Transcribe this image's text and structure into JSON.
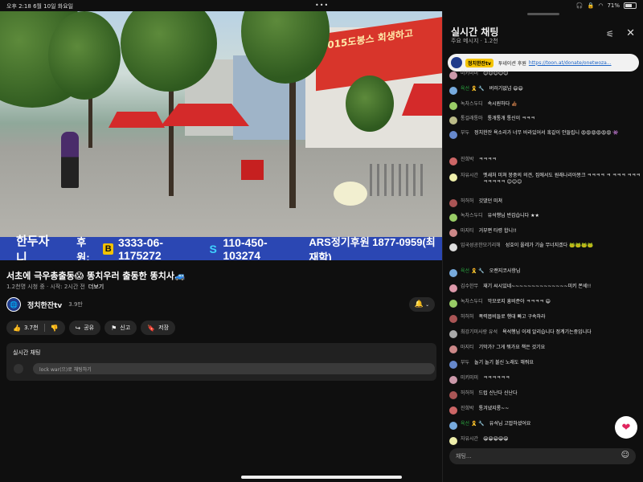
{
  "status": {
    "time": "오후 2:18",
    "date": "6월 10일 화요일",
    "battery": "71%"
  },
  "video": {
    "banner_top": "1015도봉스 회생하고",
    "ticker": {
      "name": "한두자니",
      "donate_label": "후원:",
      "acc1": "3333-06-1175272",
      "acc2": "110-450-103274",
      "ars": "ARS정기후원 1877-0959(최재학)"
    }
  },
  "info": {
    "title": "서초에 극우총출동😱 똥치우러 출동한 똥치사🚙",
    "meta": "1.2천명 시청 중 · 시작: 2시간 전",
    "more": "더보기",
    "channel": "정치한잔tv",
    "subs": "3.9만",
    "likes": "3.7천",
    "share": "공유",
    "report": "신고",
    "save": "저장",
    "live_title": "실시간 채팅",
    "live_placeholder": "lock war(으)로 채팅하기"
  },
  "chat": {
    "title": "실시간 채팅",
    "subtitle": "주요 메시지 · 1.2천",
    "pinned": {
      "author": "정치한잔tv",
      "text": "투네이션 후원",
      "link": "https://toon.at/donate/onetwoza..."
    },
    "messages": [
      {
        "author": "미키미미",
        "text": "😊😊😊😊😊",
        "color": "#c9a"
      },
      {
        "author": "육선 🎗️ 🔧",
        "text": "버러기없넘 😄😄",
        "color": "#7ad",
        "member": true
      },
      {
        "author": "녹차스두디",
        "text": "속시원하다 👍🏾",
        "color": "#9c6"
      },
      {
        "author": "통걸래통마",
        "text": "통개통개 통신이 ㅋㅋㅋ",
        "color": "#bb8"
      },
      {
        "author": "부두",
        "text": "정치한잔 욕소리가 너무 바라있어서 혹갈이 안들립니 😡😡😡😡😡😡 👾",
        "color": "#68c"
      },
      {
        "author": "진희박",
        "text": "ㅋㅋㅋㅋ",
        "color": "#c66"
      },
      {
        "author": "자유시간",
        "text": "멧새처 미쳐 붕중의 의견, 집에서도 원래나리아몽크 ㅋㅋㅋㅋ ㅋ ㅋㅋㅋ ㅋㅋㅋ ㅋㅋㅋㅋㅋ 😊😊😊",
        "color": "#eea"
      },
      {
        "author": "허허허",
        "text": "깃댔던 미쳐",
        "color": "#a55"
      },
      {
        "author": "녹차스두디",
        "text": "유석행님 반갑습니다 ★★",
        "color": "#9c6"
      },
      {
        "author": "마지티",
        "text": "거부편 타령 합니!!",
        "color": "#c88"
      },
      {
        "author": "입국성공한모기리해",
        "text": "성호이 올레가 기술 무너지겠다 🐸🐸🐸🐸",
        "color": "#ddd"
      },
      {
        "author": "육선 🎗️ 🔧",
        "text": "오랜지코사항님",
        "color": "#7ad",
        "member": true
      },
      {
        "author": "김수한무",
        "text": "재기 씨시있네~~~~~~~~~~~~~~미키 쫀세!!",
        "color": "#d9a"
      },
      {
        "author": "녹차스두디",
        "text": "악모로지 흥비준아 ㅋㅋㅋㅋ 😄",
        "color": "#9c6"
      },
      {
        "author": "허허허",
        "text": "폭력몹비들로 행대 빠고 구속하라",
        "color": "#a55"
      },
      {
        "author": "최강기미사랑 유석",
        "text": "욕석행님 이제 알리습니다 정계기는중입니다",
        "color": "#aaa"
      },
      {
        "author": "마지티",
        "text": "기막가? 그게 뭐가요 책은 것기요",
        "color": "#c88"
      },
      {
        "author": "부두",
        "text": "놀기 놀기 불신 노래도 해줘요",
        "color": "#68c"
      },
      {
        "author": "미키미미",
        "text": "ㅋㅋㅋㅋㅋㅋ",
        "color": "#c9a"
      },
      {
        "author": "허허허",
        "text": "드럽 신난다 신난다",
        "color": "#a55"
      },
      {
        "author": "진희박",
        "text": "통겨냈지롱~~",
        "color": "#c66"
      },
      {
        "author": "육선 🎗️ 🔧",
        "text": "유석님 고맙하셨어요",
        "color": "#7ad",
        "member": true
      },
      {
        "author": "자유시간",
        "text": "😁😁😁😁😁",
        "color": "#eea"
      }
    ],
    "input_placeholder": "채팅..."
  }
}
